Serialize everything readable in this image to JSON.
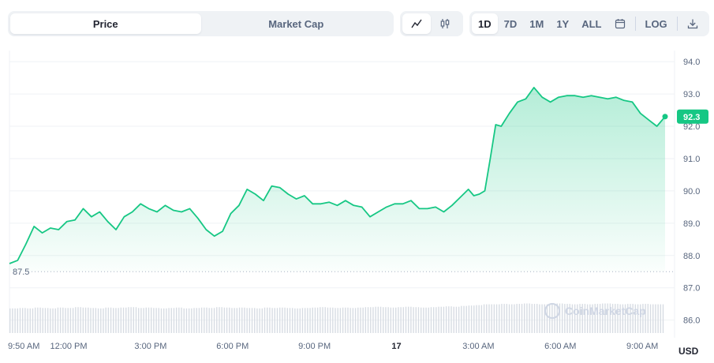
{
  "toolbar": {
    "type_tabs": [
      "Price",
      "Market Cap"
    ],
    "active_type": "Price",
    "view_icons": [
      "line-chart-icon",
      "candlestick-icon"
    ],
    "range_tabs": [
      "1D",
      "7D",
      "1M",
      "1Y",
      "ALL"
    ],
    "active_range": "1D",
    "calendar_icon": "calendar-icon",
    "log_label": "LOG",
    "download_icon": "download-icon"
  },
  "chart_data": {
    "type": "area",
    "currency": "USD",
    "ylim": [
      85.6,
      94.2
    ],
    "y_ticks": [
      86.0,
      87.0,
      88.0,
      89.0,
      90.0,
      91.0,
      92.0,
      93.0,
      94.0
    ],
    "y_tick_labels": [
      "86.0",
      "87.0",
      "88.0",
      "89.0",
      "90.0",
      "91.0",
      "92.0",
      "93.0",
      "94.0"
    ],
    "x_tick_labels": [
      "9:50 AM",
      "12:00 PM",
      "3:00 PM",
      "6:00 PM",
      "9:00 PM",
      "17",
      "3:00 AM",
      "6:00 AM",
      "9:00 AM"
    ],
    "x_tick_hours": [
      0,
      2.1667,
      5.1667,
      8.1667,
      11.1667,
      14.1667,
      17.1667,
      20.1667,
      23.1667
    ],
    "open_price": 87.5,
    "open_label": "87.5",
    "last_price": 92.3,
    "last_label": "92.3",
    "line_color": "#16c784",
    "series": [
      {
        "x_hours": [
          0,
          0.3,
          0.6,
          0.9,
          1.2,
          1.5,
          1.8,
          2.1,
          2.4,
          2.7,
          3.0,
          3.3,
          3.6,
          3.9,
          4.2,
          4.5,
          4.8,
          5.1,
          5.4,
          5.7,
          6.0,
          6.3,
          6.6,
          6.9,
          7.2,
          7.5,
          7.8,
          8.1,
          8.4,
          8.7,
          9.0,
          9.3,
          9.6,
          9.9,
          10.2,
          10.5,
          10.8,
          11.1,
          11.4,
          11.7,
          12.0,
          12.3,
          12.6,
          12.9,
          13.2,
          13.5,
          13.8,
          14.1,
          14.4,
          14.7,
          15.0,
          15.3,
          15.6,
          15.9,
          16.2,
          16.5,
          16.8,
          17.0,
          17.2,
          17.4,
          17.6,
          17.8,
          18.0,
          18.3,
          18.6,
          18.9,
          19.2,
          19.5,
          19.8,
          20.1,
          20.4,
          20.7,
          21.0,
          21.3,
          21.6,
          21.9,
          22.2,
          22.5,
          22.8,
          23.1,
          23.4,
          23.7,
          24.0
        ],
        "values": [
          87.75,
          87.85,
          88.35,
          88.9,
          88.7,
          88.85,
          88.8,
          89.05,
          89.1,
          89.45,
          89.2,
          89.35,
          89.05,
          88.8,
          89.2,
          89.35,
          89.6,
          89.45,
          89.35,
          89.55,
          89.4,
          89.35,
          89.45,
          89.15,
          88.8,
          88.6,
          88.75,
          89.3,
          89.55,
          90.05,
          89.9,
          89.7,
          90.15,
          90.1,
          89.9,
          89.75,
          89.85,
          89.6,
          89.6,
          89.65,
          89.55,
          89.7,
          89.55,
          89.5,
          89.2,
          89.35,
          89.5,
          89.6,
          89.6,
          89.7,
          89.45,
          89.45,
          89.5,
          89.35,
          89.55,
          89.8,
          90.05,
          89.85,
          89.9,
          90.0,
          91.0,
          92.05,
          92.0,
          92.4,
          92.75,
          92.85,
          93.2,
          92.9,
          92.75,
          92.9,
          92.95,
          92.95,
          92.9,
          92.95,
          92.9,
          92.85,
          92.9,
          92.8,
          92.75,
          92.4,
          92.2,
          92.0,
          92.3
        ]
      }
    ],
    "volume": [
      60,
      61,
      60,
      62,
      61,
      60,
      62,
      61,
      63,
      62,
      61,
      60,
      62,
      61,
      62,
      63,
      61,
      62,
      61,
      60,
      61,
      62,
      60,
      61,
      62,
      61,
      63,
      62,
      61,
      62,
      61,
      60,
      62,
      61,
      62,
      61,
      60,
      61,
      62,
      63,
      62,
      61,
      62,
      61,
      62,
      63,
      64,
      63,
      62,
      63,
      64,
      63,
      62,
      63,
      64,
      65,
      64,
      66,
      67,
      68,
      70,
      70,
      71,
      70,
      71,
      72,
      71,
      70,
      71,
      72,
      71,
      70,
      71,
      70,
      71,
      72,
      71,
      70,
      71,
      70,
      71,
      70,
      70
    ],
    "watermark": "CoinMarketCap",
    "grid": true
  }
}
